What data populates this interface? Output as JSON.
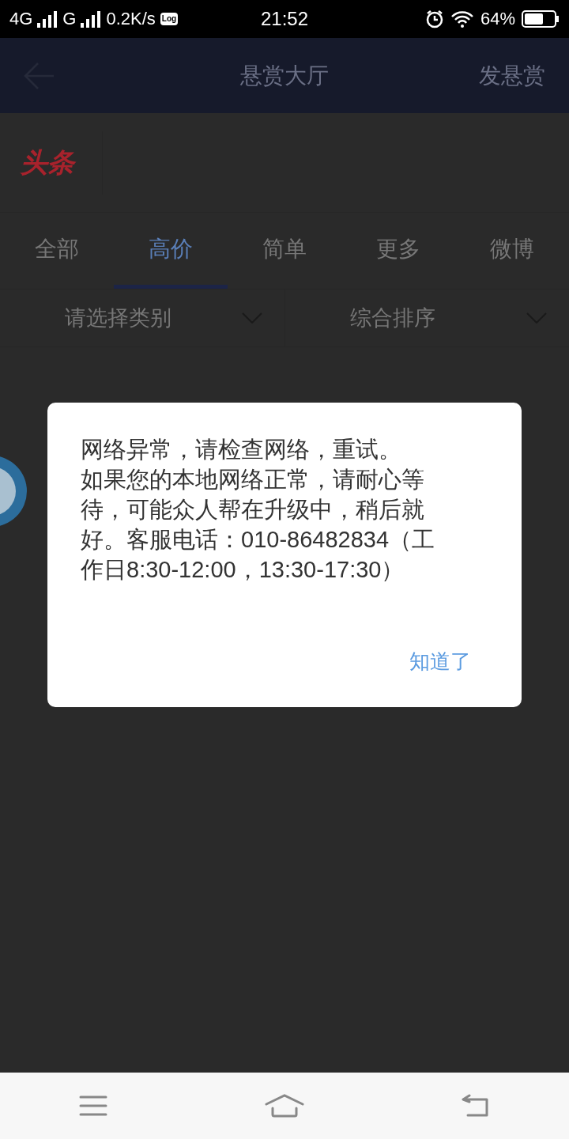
{
  "status_bar": {
    "network_1": "4G",
    "network_2": "G",
    "speed": "0.2K/s",
    "log_badge": "Log",
    "time": "21:52",
    "battery": "64%"
  },
  "header": {
    "title": "悬赏大厅",
    "action": "发悬赏"
  },
  "logo": "头条",
  "tabs": [
    {
      "label": "全部",
      "selected": false
    },
    {
      "label": "高价",
      "selected": true
    },
    {
      "label": "简单",
      "selected": false
    },
    {
      "label": "更多",
      "selected": false
    },
    {
      "label": "微博",
      "selected": false
    }
  ],
  "filters": [
    {
      "label": "请选择类别"
    },
    {
      "label": "综合排序"
    }
  ],
  "dialog": {
    "messages": [
      "网络异常，请检查网络，重试。",
      "如果您的本地网络正常，请耐心等待，可能众人帮在升级中，稍后就好。客服电话：010-86482834（工作日8:30-12:00，13:30-17:30）"
    ],
    "button": "知道了"
  }
}
